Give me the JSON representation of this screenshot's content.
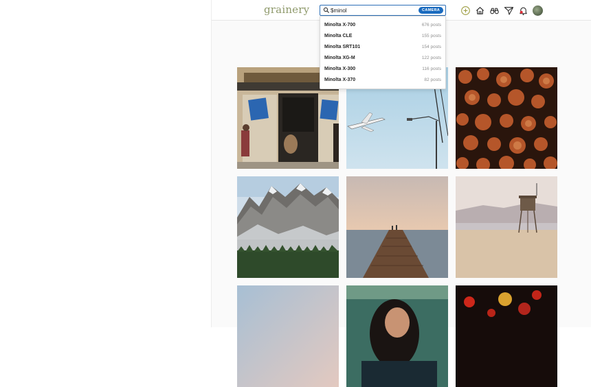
{
  "header": {
    "logo": "grainery",
    "search": {
      "value": "$minol",
      "badge": "CAMERA"
    }
  },
  "nav": [
    "add-post-icon",
    "home-icon",
    "explore-binoculars-icon",
    "messages-paper-plane-icon",
    "notifications-bell-icon",
    "profile-avatar"
  ],
  "search_results": [
    {
      "name": "Minolta X-700",
      "count": "676 posts"
    },
    {
      "name": "Minolta CLE",
      "count": "155 posts"
    },
    {
      "name": "Minolta SRT101",
      "count": "154 posts"
    },
    {
      "name": "Minolta XG-M",
      "count": "122 posts"
    },
    {
      "name": "Minolta X-300",
      "count": "116 posts"
    },
    {
      "name": "Minolta X-370",
      "count": "82 posts"
    }
  ],
  "colors": {
    "logo": "#8f9a6c",
    "search_border": "#2c6fb7",
    "badge": "#1a6bbf"
  },
  "feed": {
    "photos": [
      {
        "subject": "storefront-with-blue-signs"
      },
      {
        "subject": "airplane-in-sky"
      },
      {
        "subject": "stacked-firewood"
      },
      {
        "subject": "mountain-range"
      },
      {
        "subject": "pier-at-sunset"
      },
      {
        "subject": "lifeguard-tower-on-beach"
      },
      {
        "subject": "pastel-sky"
      },
      {
        "subject": "portrait-woman"
      },
      {
        "subject": "red-lights"
      }
    ]
  }
}
